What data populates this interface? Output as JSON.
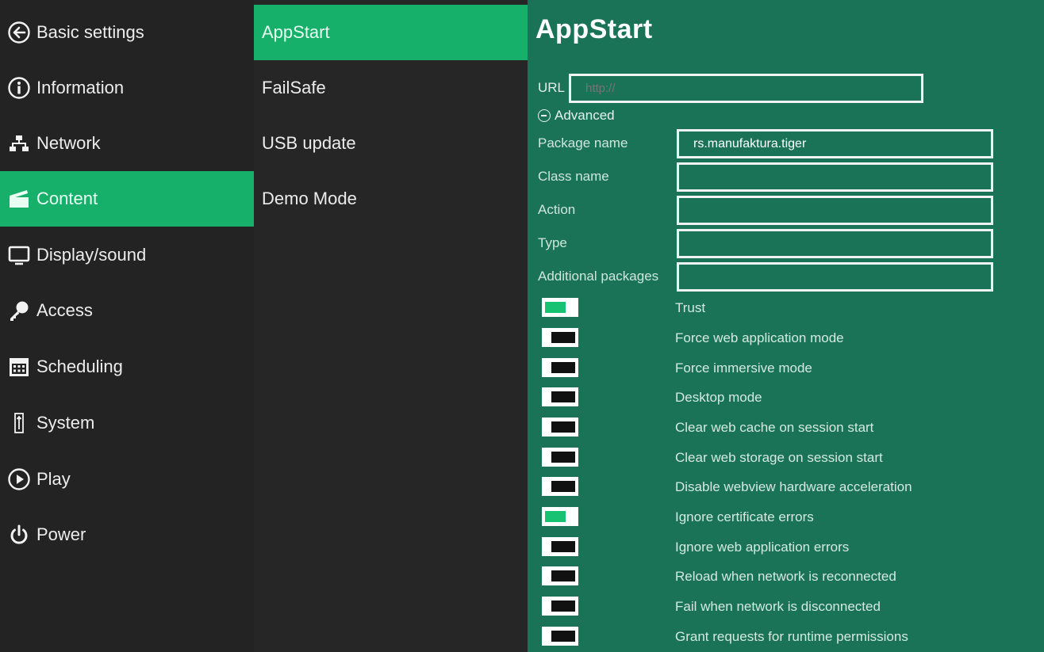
{
  "main_nav": {
    "items": [
      {
        "label": "Basic settings",
        "icon": "back-arrow-icon",
        "active": false
      },
      {
        "label": "Information",
        "icon": "info-icon",
        "active": false
      },
      {
        "label": "Network",
        "icon": "network-icon",
        "active": false
      },
      {
        "label": "Content",
        "icon": "clapperboard-icon",
        "active": true
      },
      {
        "label": "Display/sound",
        "icon": "monitor-icon",
        "active": false
      },
      {
        "label": "Access",
        "icon": "key-icon",
        "active": false
      },
      {
        "label": "Scheduling",
        "icon": "calendar-icon",
        "active": false
      },
      {
        "label": "System",
        "icon": "system-icon",
        "active": false
      },
      {
        "label": "Play",
        "icon": "play-icon",
        "active": false
      },
      {
        "label": "Power",
        "icon": "power-icon",
        "active": false
      }
    ]
  },
  "sub_nav": {
    "items": [
      {
        "label": "AppStart",
        "active": true
      },
      {
        "label": "FailSafe",
        "active": false
      },
      {
        "label": "USB update",
        "active": false
      },
      {
        "label": "Demo Mode",
        "active": false
      }
    ]
  },
  "panel": {
    "title": "AppStart",
    "url": {
      "label": "URL",
      "placeholder": "http://",
      "value": ""
    },
    "advanced_label": "Advanced",
    "fields": [
      {
        "label": "Package name",
        "value": "rs.manufaktura.tiger"
      },
      {
        "label": "Class name",
        "value": ""
      },
      {
        "label": "Action",
        "value": ""
      },
      {
        "label": "Type",
        "value": ""
      },
      {
        "label": "Additional packages",
        "value": ""
      }
    ],
    "toggles": [
      {
        "label": "Trust",
        "on": true
      },
      {
        "label": "Force web application mode",
        "on": false
      },
      {
        "label": "Force immersive mode",
        "on": false
      },
      {
        "label": "Desktop mode",
        "on": false
      },
      {
        "label": "Clear web cache on session start",
        "on": false
      },
      {
        "label": "Clear web storage on session start",
        "on": false
      },
      {
        "label": "Disable webview hardware acceleration",
        "on": false
      },
      {
        "label": "Ignore certificate errors",
        "on": true
      },
      {
        "label": "Ignore web application errors",
        "on": false
      },
      {
        "label": "Reload when network is reconnected",
        "on": false
      },
      {
        "label": "Fail when network is disconnected",
        "on": false
      },
      {
        "label": "Grant requests for runtime permissions",
        "on": false
      }
    ]
  },
  "colors": {
    "accent": "#16b06a",
    "panel_bg": "#1a7357",
    "sidebar_bg": "#232323",
    "toggle_on": "#18c273"
  }
}
